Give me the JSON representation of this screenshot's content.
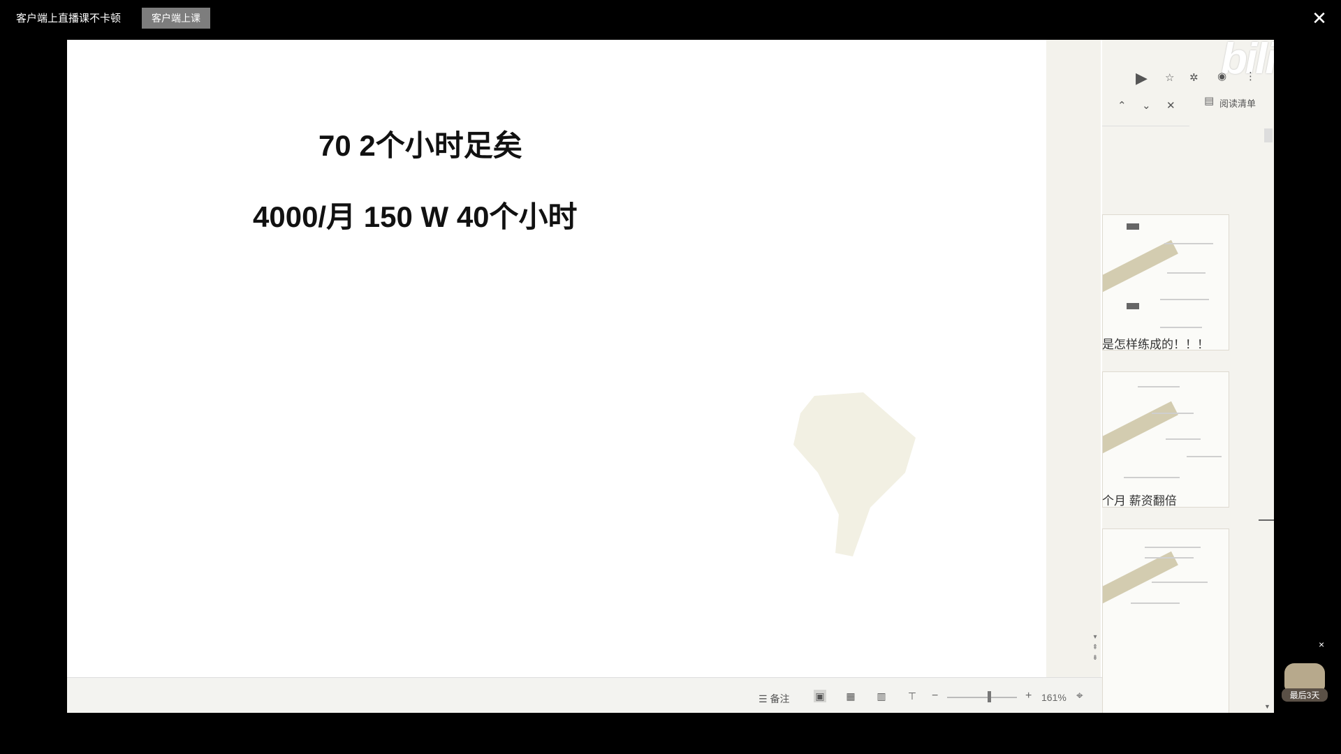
{
  "topbar": {
    "hint_text": "客户端上直播课不卡顿",
    "client_button_label": "客户端上课",
    "close_glyph": "✕"
  },
  "slide": {
    "line1": "70 2个小时足矣",
    "line2": "4000/月  150 W 40个小时"
  },
  "statusbar": {
    "notes_label": "备注",
    "zoom_value": "161%",
    "icons": [
      "notes-icon",
      "normal-view-icon",
      "slide-sorter-icon",
      "reading-view-icon",
      "slideshow-icon",
      "fit-window-icon"
    ]
  },
  "right_panel": {
    "logo_text": "bilibili",
    "reading_list_label": "阅读清单",
    "captions": [
      "是怎样练成的！！！",
      "个月 薪资翻倍"
    ]
  },
  "badge": {
    "label": "最后3天",
    "close_glyph": "×"
  },
  "colors": {
    "background": "#000000",
    "slide_bg": "#ffffff",
    "panel_bg": "#f4f3ee",
    "button_bg": "#7d7d7d"
  }
}
